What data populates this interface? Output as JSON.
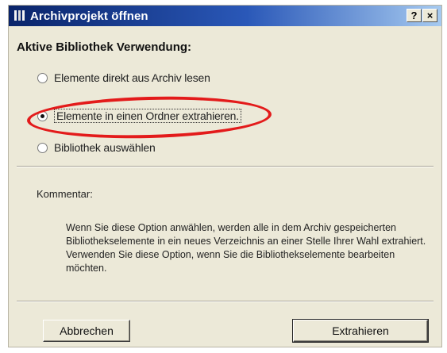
{
  "window": {
    "title": "Archivprojekt öffnen",
    "help_label": "?",
    "close_label": "×"
  },
  "section_heading": "Aktive Bibliothek Verwendung:",
  "options": [
    {
      "label": "Elemente direkt aus Archiv lesen",
      "selected": false
    },
    {
      "label": "Elemente in einen Ordner extrahieren.",
      "selected": true
    },
    {
      "label": "Bibliothek auswählen",
      "selected": false
    }
  ],
  "comment": {
    "label": "Kommentar:",
    "text": "Wenn Sie diese Option anwählen, werden alle in dem Archiv gespeicherten Bibliothekselemente in ein neues Verzeichnis an einer Stelle Ihrer Wahl extrahiert. Verwenden Sie diese Option, wenn Sie die Bibliothekselemente bearbeiten möchten."
  },
  "buttons": {
    "cancel": "Abbrechen",
    "extract": "Extrahieren"
  },
  "colors": {
    "dialog_bg": "#ece9d8",
    "titlebar_start": "#0a246a",
    "titlebar_end": "#a6caf0",
    "annotation_ellipse": "#e31b1b"
  }
}
